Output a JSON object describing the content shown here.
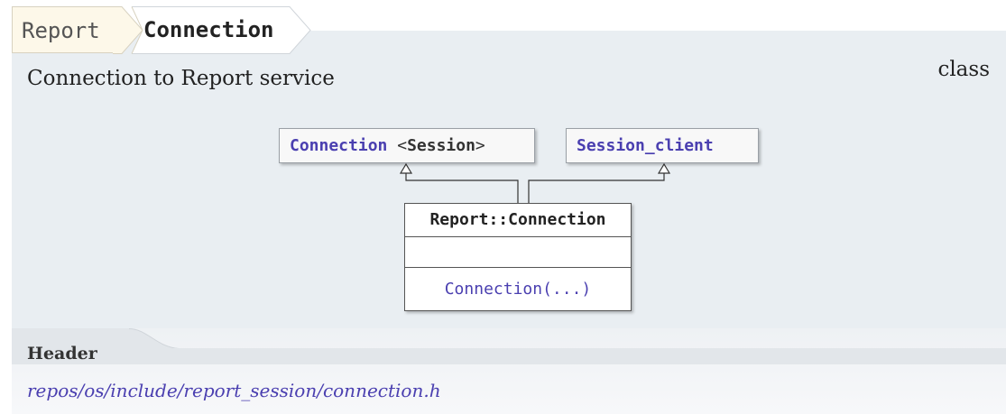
{
  "breadcrumb": {
    "items": [
      {
        "label": "Report"
      },
      {
        "label": "Connection"
      }
    ]
  },
  "summary": {
    "description": "Connection to Report service",
    "kind": "class"
  },
  "diagram": {
    "bases": [
      {
        "name": "Connection",
        "template_open": "<",
        "template_arg": "Session",
        "template_close": ">"
      },
      {
        "name": "Session_client"
      }
    ],
    "class_box": {
      "name": "Report::Connection",
      "methods": [
        "Connection(...)"
      ]
    }
  },
  "header_section": {
    "label": "Header",
    "path": "repos/os/include/report_session/connection.h"
  },
  "colors": {
    "panel_bg": "#e9eef2",
    "link": "#4a3fb0",
    "crumb_bg": "#fdf8e9"
  }
}
